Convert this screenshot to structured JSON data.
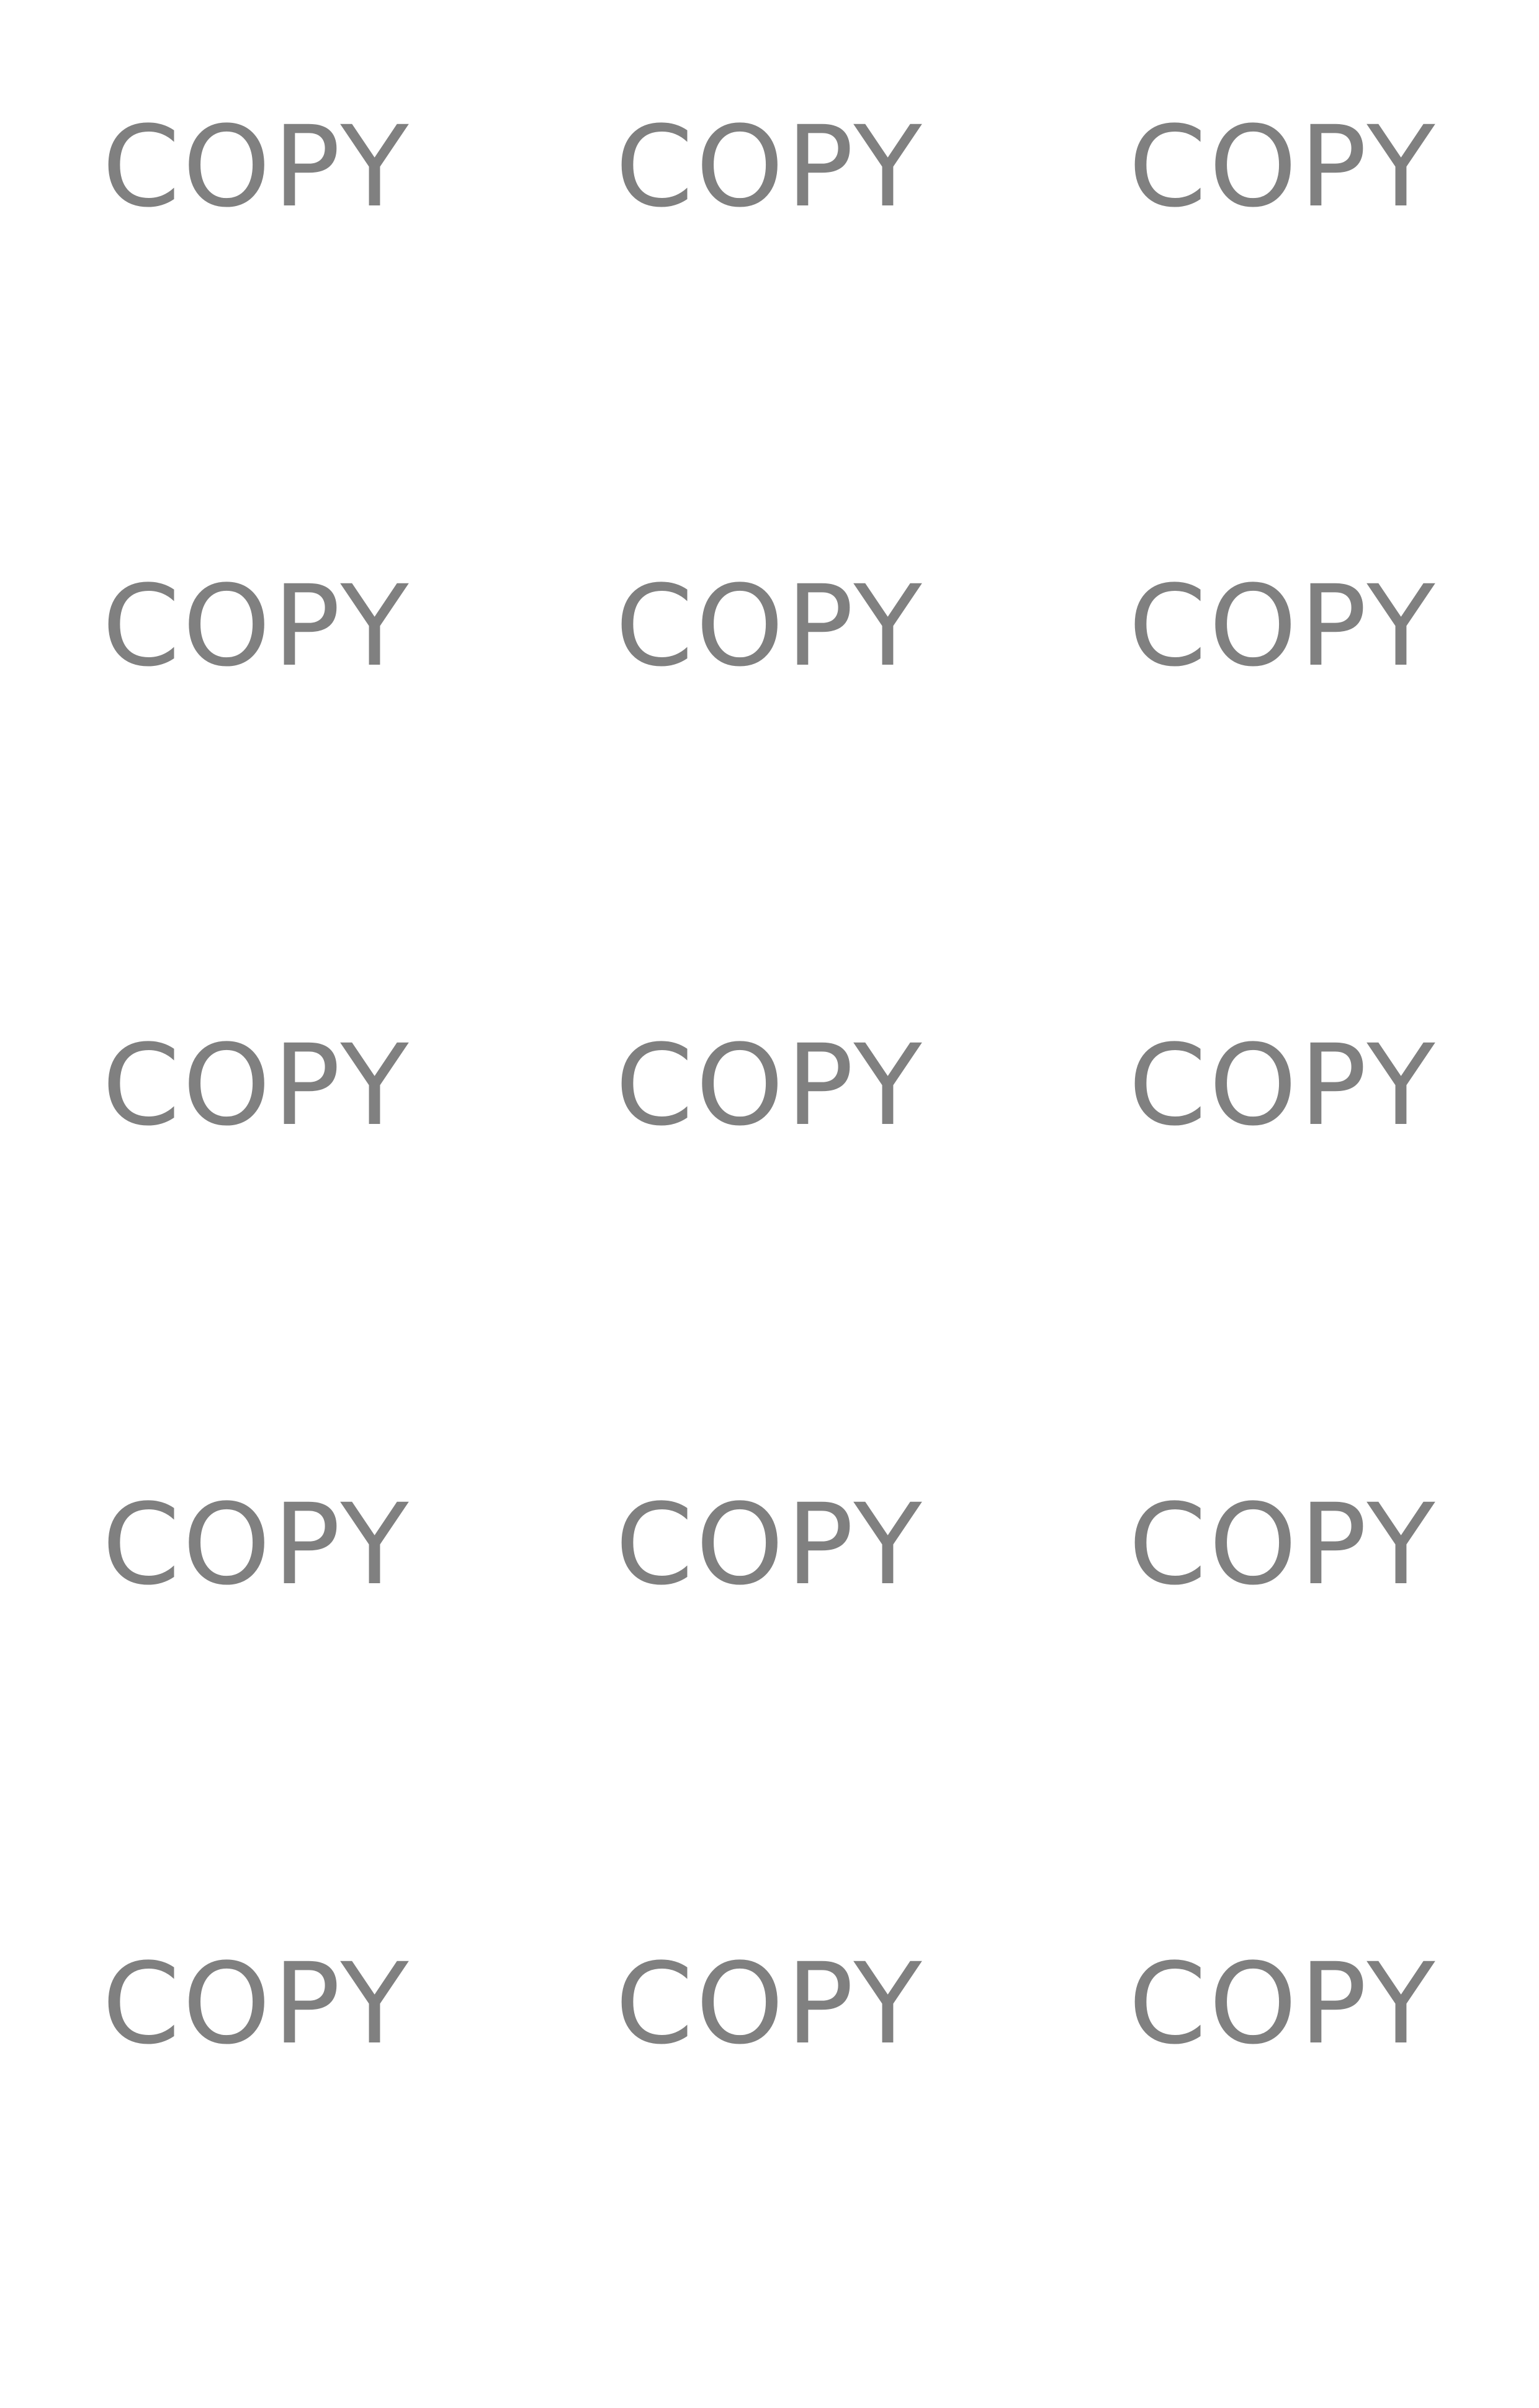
{
  "watermark": {
    "text": "COPY",
    "color": "#808080",
    "rows": 5,
    "columns": 3
  }
}
